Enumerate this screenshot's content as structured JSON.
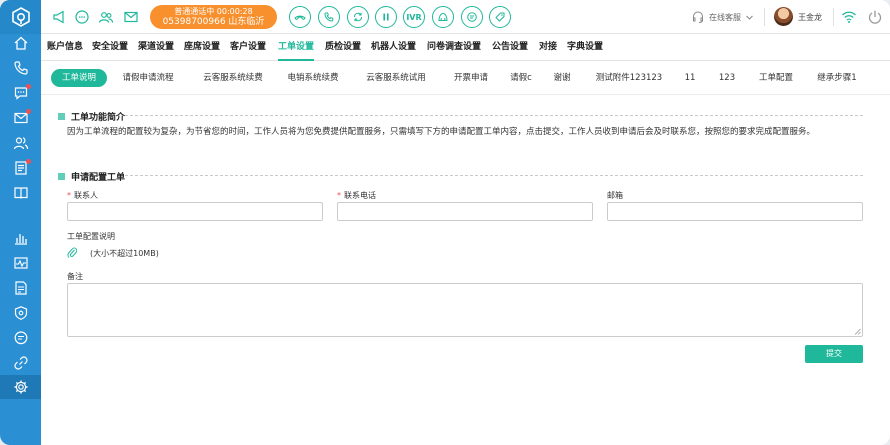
{
  "topbar": {
    "call_status": "普通通话中  00:00:28",
    "call_number": "05398700966  山东临沂",
    "ivr_label": "IVR",
    "agent_status": "在线客服",
    "user_name": "王金龙"
  },
  "menu": {
    "items": [
      "账户信息",
      "安全设置",
      "渠道设置",
      "座席设置",
      "客户设置",
      "工单设置",
      "质检设置",
      "机器人设置",
      "问卷调查设置",
      "公告设置",
      "对接",
      "字典设置"
    ],
    "active_index": 5
  },
  "subtabs": {
    "items": [
      "工单说明",
      "请假申请流程",
      "云客服系统续费",
      "电销系统续费",
      "云客服系统试用",
      "开票申请",
      "请假c",
      "谢谢",
      "测试附件123123",
      "11",
      "123",
      "工单配置",
      "继承步骤1"
    ],
    "active_index": 0
  },
  "intro": {
    "title": "工单功能简介",
    "text": "因为工单流程的配置较为复杂，为节省您的时间，工作人员将为您免费提供配置服务，只需填写下方的申请配置工单内容，点击提交，工作人员收到申请后会及时联系您，按照您的要求完成配置服务。"
  },
  "form": {
    "title": "申请配置工单",
    "contact_label": "联系人",
    "phone_label": "联系电话",
    "email_label": "邮箱",
    "required_mark": "*",
    "attachment_label": "工单配置说明",
    "attachment_hint": "(大小不超过10MB)",
    "remark_label": "备注",
    "submit_label": "提交"
  },
  "colors": {
    "sidebar": "#2a8fd3",
    "accent": "#1fb89a",
    "call_pill": "#f8902e",
    "badge": "#f0504f"
  }
}
